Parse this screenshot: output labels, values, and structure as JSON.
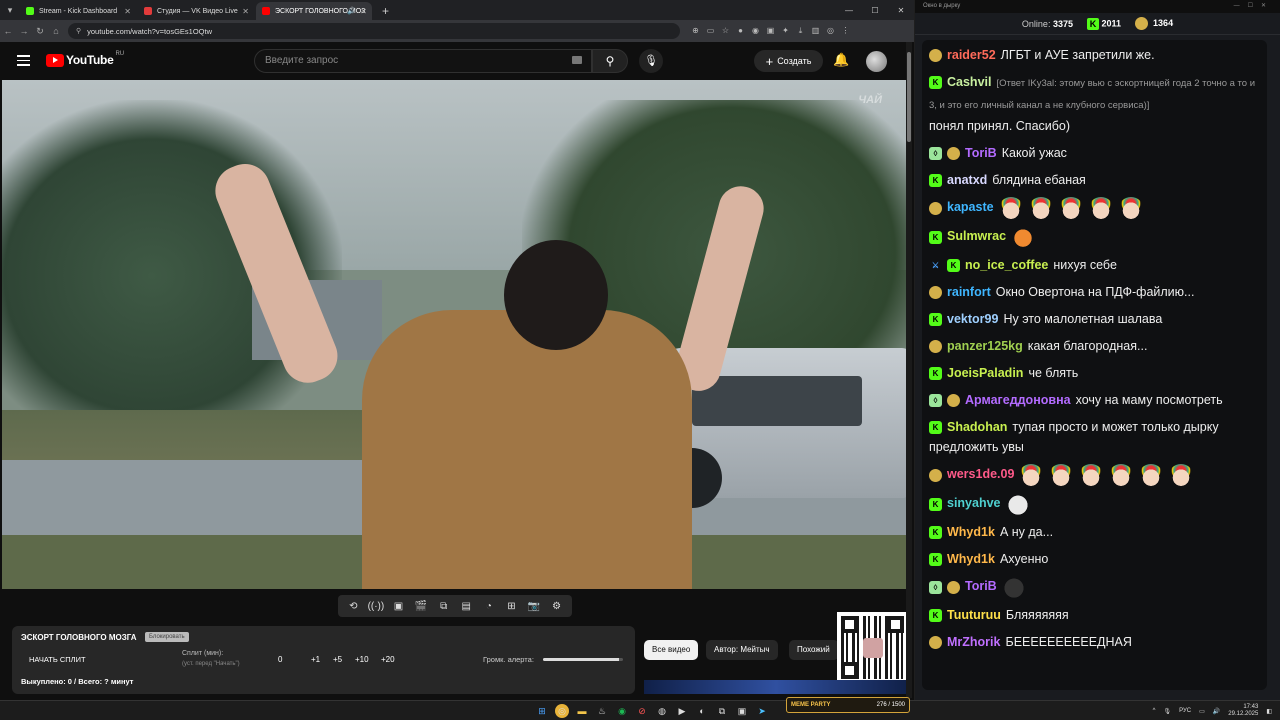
{
  "browser": {
    "tabs": [
      {
        "title": "Stream - Kick Dashboard",
        "color": "#53fc18",
        "close": "✕"
      },
      {
        "title": "Студия — VK Видео Live",
        "color": "#e23b3b",
        "close": "✕"
      },
      {
        "title": "ЭСКОРТ ГОЛОВНОГО МОЗ",
        "color": "#ff0000",
        "close": "✕",
        "audio": "🔊",
        "active": true
      }
    ],
    "new_tab": "+",
    "url": "youtube.com/watch?v=tosGEs1OQtw"
  },
  "youtube": {
    "logo_text": "YouTube",
    "region": "RU",
    "search_placeholder": "Введите запрос",
    "create_label": "Создать",
    "create_icon": "+"
  },
  "stream_panel": {
    "title": "ЭСКОРТ ГОЛОВНОГО МОЗГА",
    "tag": "Блокировать",
    "split_button": "НАЧАТЬ СПЛИТ",
    "split_label": "Сплит (мин):",
    "split_sub": "(уст. перед \"Начать\")",
    "split_value": "0",
    "increments": [
      "+1",
      "+5",
      "+10",
      "+20"
    ],
    "alert_volume_label": "Громк. алерта:",
    "alert_volume": 0.95,
    "footer": "Выкуплено: 0 / Всего: ? минут"
  },
  "video_chips": {
    "all": "Все видео",
    "author": "Автор: Мейтыч",
    "similar": "Похожий"
  },
  "video_watermark": "ЧАЙ",
  "chat_window": {
    "title": "Окно в дырку"
  },
  "chat": {
    "online_label": "Online:",
    "online_count": "3375",
    "kick_count": "2011",
    "other_count": "1364",
    "messages": [
      {
        "user": "raider52",
        "color": "#ff6b5a",
        "badges": [
          "f"
        ],
        "text": "ЛГБТ и АУЕ запретили же."
      },
      {
        "user": "Cashvil",
        "color": "#c8f0a0",
        "badges": [
          "k"
        ],
        "reply": "[Ответ IKy3al: этому вью с эскортницей года 2 точно а то и 3, и это его личный канал а не клубного сервиса)]",
        "text": "понял принял. Спасибо)"
      },
      {
        "user": "ToriB",
        "color": "#b36bff",
        "badges": [
          "s",
          "f"
        ],
        "text": "Какой ужас"
      },
      {
        "user": "anatxd",
        "color": "#d9d9ff",
        "badges": [
          "k"
        ],
        "text": "блядина ебаная"
      },
      {
        "user": "kapaste",
        "color": "#3fb6ff",
        "badges": [
          "f"
        ],
        "emotes": [
          "clown",
          "clown",
          "clown",
          "clown",
          "clown"
        ]
      },
      {
        "user": "Sulmwrac",
        "color": "#c8f050",
        "badges": [
          "k"
        ],
        "emotes": [
          "fox"
        ]
      },
      {
        "user": "no_ice_coffee",
        "color": "#c8f050",
        "badges": [
          "m",
          "k"
        ],
        "text": "нихуя себе"
      },
      {
        "user": "rainfort",
        "color": "#3fb6ff",
        "badges": [
          "f"
        ],
        "text": "Окно Овертона на ПДФ-файлию..."
      },
      {
        "user": "vektor99",
        "color": "#9fd0ff",
        "badges": [
          "k"
        ],
        "text": "Ну это малолетная шалава"
      },
      {
        "user": "panzer125kg",
        "color": "#a0d050",
        "badges": [
          "f"
        ],
        "text": "какая благородная..."
      },
      {
        "user": "JoeisPaladin",
        "color": "#c8f050",
        "badges": [
          "k"
        ],
        "text": "че блять"
      },
      {
        "user": "Армагеддоновна",
        "color": "#b36bff",
        "badges": [
          "s",
          "f"
        ],
        "text": "хочу на маму посмотреть"
      },
      {
        "user": "Shadohan",
        "color": "#c8f050",
        "badges": [
          "k"
        ],
        "text": "тупая просто и может только дырку предложить увы"
      },
      {
        "user": "wers1de.09",
        "color": "#ff5a8a",
        "badges": [
          "f"
        ],
        "emotes": [
          "clown",
          "clown",
          "clown",
          "clown",
          "clown",
          "clown"
        ]
      },
      {
        "user": "sinyahve",
        "color": "#4fd0d0",
        "badges": [
          "k"
        ],
        "emotes": [
          "cat"
        ]
      },
      {
        "user": "Whyd1k",
        "color": "#ffb84a",
        "badges": [
          "k"
        ],
        "text": "А ну да..."
      },
      {
        "user": "Whyd1k",
        "color": "#ffb84a",
        "badges": [
          "k"
        ],
        "text": "Ахуенно"
      },
      {
        "user": "ToriB",
        "color": "#b36bff",
        "badges": [
          "s",
          "f"
        ],
        "emotes": [
          "dark"
        ]
      },
      {
        "user": "Tuuturuu",
        "color": "#ffe04a",
        "badges": [
          "k"
        ],
        "text": "Бляяяяяяя"
      },
      {
        "user": "MrZhorik",
        "color": "#c070ff",
        "badges": [
          "f"
        ],
        "text": "БЕЕЕЕЕЕЕЕЕЕДНАЯ"
      }
    ]
  },
  "memes_widget": {
    "title": "MEME PARTY",
    "value": "276 / 1500"
  },
  "taskbar": {
    "lang": "РУС",
    "time": "17:43",
    "date": "29.12.2025"
  }
}
